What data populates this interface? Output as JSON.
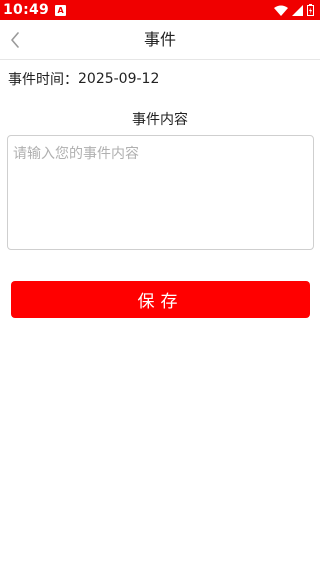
{
  "status_bar": {
    "time": "10:49",
    "app_icon_glyph": "A",
    "icons": [
      "wifi-icon",
      "cell-signal-icon",
      "battery-icon"
    ],
    "background_color": "#f00000"
  },
  "nav": {
    "back_icon": "chevron-left-icon",
    "title": "事件"
  },
  "event_time": {
    "label": "事件时间：",
    "value": "2025-09-12"
  },
  "content": {
    "label": "事件内容",
    "placeholder": "请输入您的事件内容",
    "value": ""
  },
  "save_button": {
    "label": "保存",
    "color": "#ff0000"
  }
}
